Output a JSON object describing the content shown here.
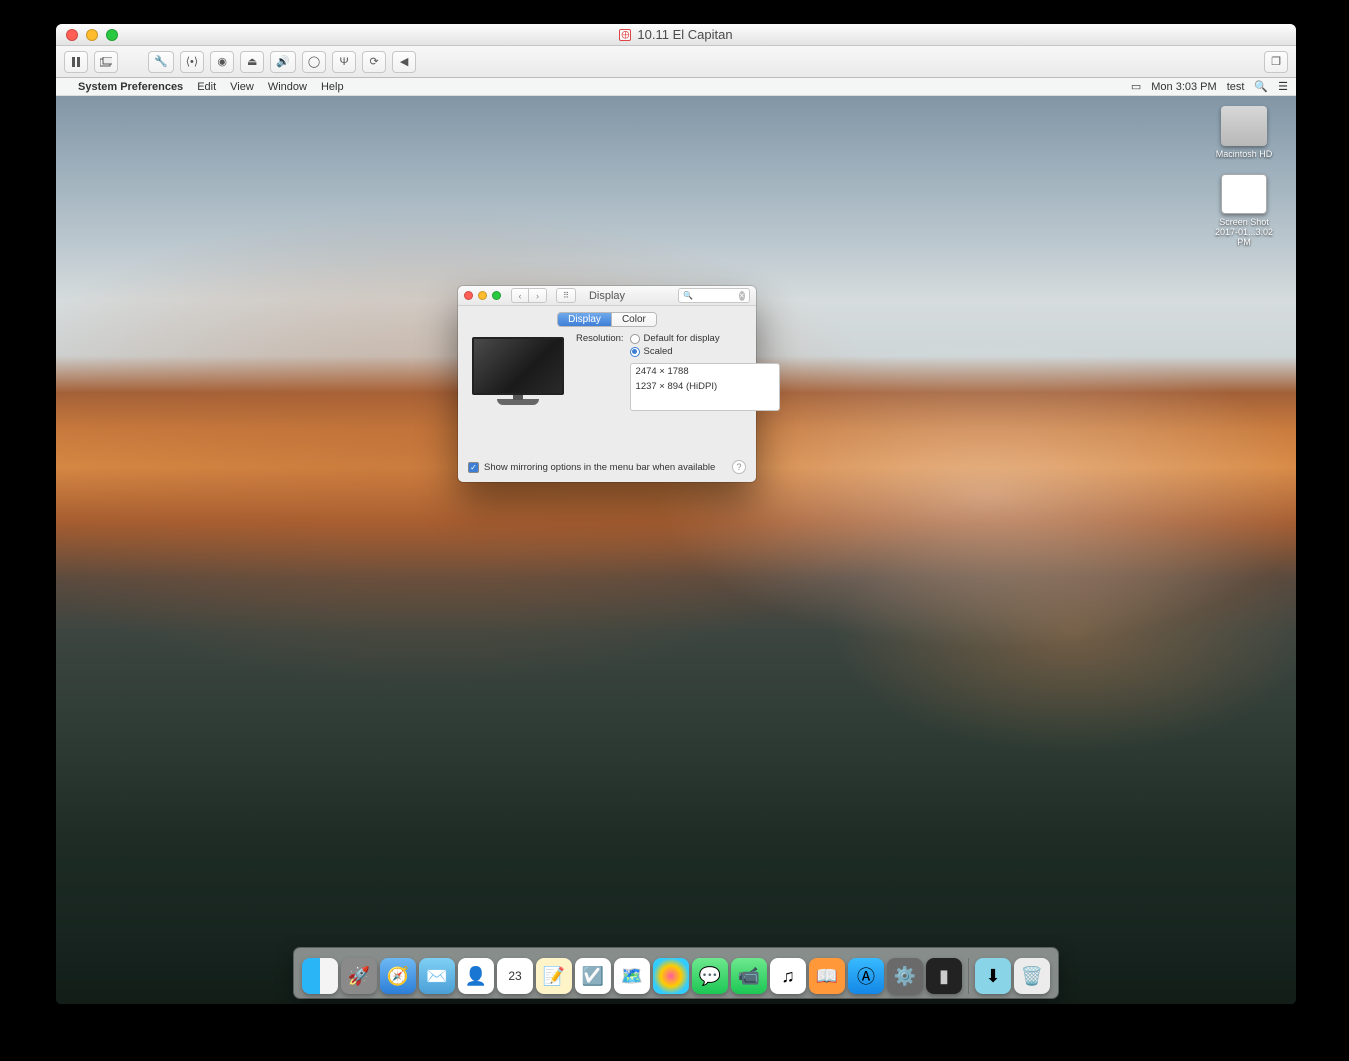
{
  "host": {
    "title": "10.11 El Capitan",
    "toolbar": {
      "pause": "pause-icon",
      "snapshot": "snapshot-icon",
      "settings": "wrench-icon",
      "fullscreen": "fullscreen-icon",
      "disk": "disk-icon",
      "lock": "lock-icon",
      "sound": "sound-icon",
      "camera": "camera-icon",
      "usb": "usb-icon",
      "sync": "sync-icon",
      "back": "back-icon",
      "windows": "windows-icon"
    }
  },
  "menubar": {
    "apple": "",
    "app": "System Preferences",
    "items": [
      "Edit",
      "View",
      "Window",
      "Help"
    ],
    "right": {
      "display_icon": "display-menu-icon",
      "time": "Mon 3:03 PM",
      "user": "test",
      "search": "search-icon",
      "menu": "menu-icon"
    }
  },
  "desktop": {
    "hd_label": "Macintosh HD",
    "screenshot_label": "Screen Shot 2017-01...3.02 PM"
  },
  "prefs": {
    "title": "Display",
    "search_placeholder": "",
    "tabs": {
      "display": "Display",
      "color": "Color"
    },
    "resolution_label": "Resolution:",
    "radio_default": "Default for display",
    "radio_scaled": "Scaled",
    "resolutions": [
      "2474 × 1788",
      "1237 × 894 (HiDPI)"
    ],
    "mirror_label": "Show mirroring options in the menu bar when available",
    "help": "?"
  },
  "dock": {
    "apps": [
      "Finder",
      "Launchpad",
      "Safari",
      "Mail",
      "Contacts",
      "Calendar",
      "Notes",
      "Reminders",
      "Maps",
      "Photos",
      "Messages",
      "FaceTime",
      "iTunes",
      "iBooks",
      "App Store",
      "System Preferences",
      "Terminal"
    ],
    "cal_day": "23",
    "right": [
      "Downloads",
      "Trash"
    ]
  }
}
